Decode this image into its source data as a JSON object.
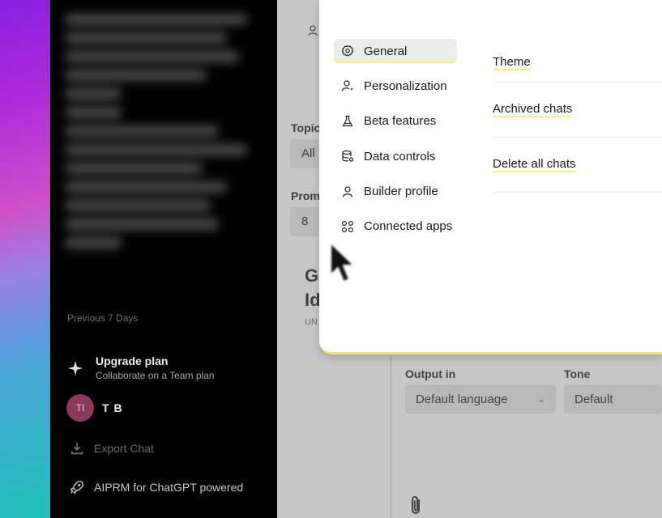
{
  "sidebar": {
    "section_label": "Previous 7 Days",
    "upgrade": {
      "title": "Upgrade plan",
      "subtitle": "Collaborate on a Team plan"
    },
    "user": {
      "initials": "TI",
      "name": "T B"
    },
    "export_label": "Export Chat",
    "aiprm_label": "AIPRM for ChatGPT powered"
  },
  "main": {
    "topic_label": "Topic",
    "topic_value": "All",
    "prompt_label": "Prom",
    "prompt_value": "8",
    "heading_line1": "G",
    "heading_line2": "Id",
    "subtext": "UN",
    "output_label": "Output in",
    "output_value": "Default language",
    "tone_label": "Tone",
    "tone_value": "Default"
  },
  "settings": {
    "nav": [
      {
        "label": "General",
        "icon": "gear-icon",
        "active": true
      },
      {
        "label": "Personalization",
        "icon": "person-sparkle-icon"
      },
      {
        "label": "Beta features",
        "icon": "flask-icon"
      },
      {
        "label": "Data controls",
        "icon": "database-gear-icon"
      },
      {
        "label": "Builder profile",
        "icon": "person-icon"
      },
      {
        "label": "Connected apps",
        "icon": "apps-grid-icon"
      }
    ],
    "rows": [
      {
        "label": "Theme"
      },
      {
        "label": "Archived chats"
      },
      {
        "label": "Delete all chats"
      }
    ]
  },
  "colors": {
    "sidebar_bg": "#000000",
    "modal_bg": "#ffffff",
    "active_nav_bg": "#ececec",
    "avatar_bg": "#8a3a5b",
    "highlight": "#f2ea5c"
  }
}
